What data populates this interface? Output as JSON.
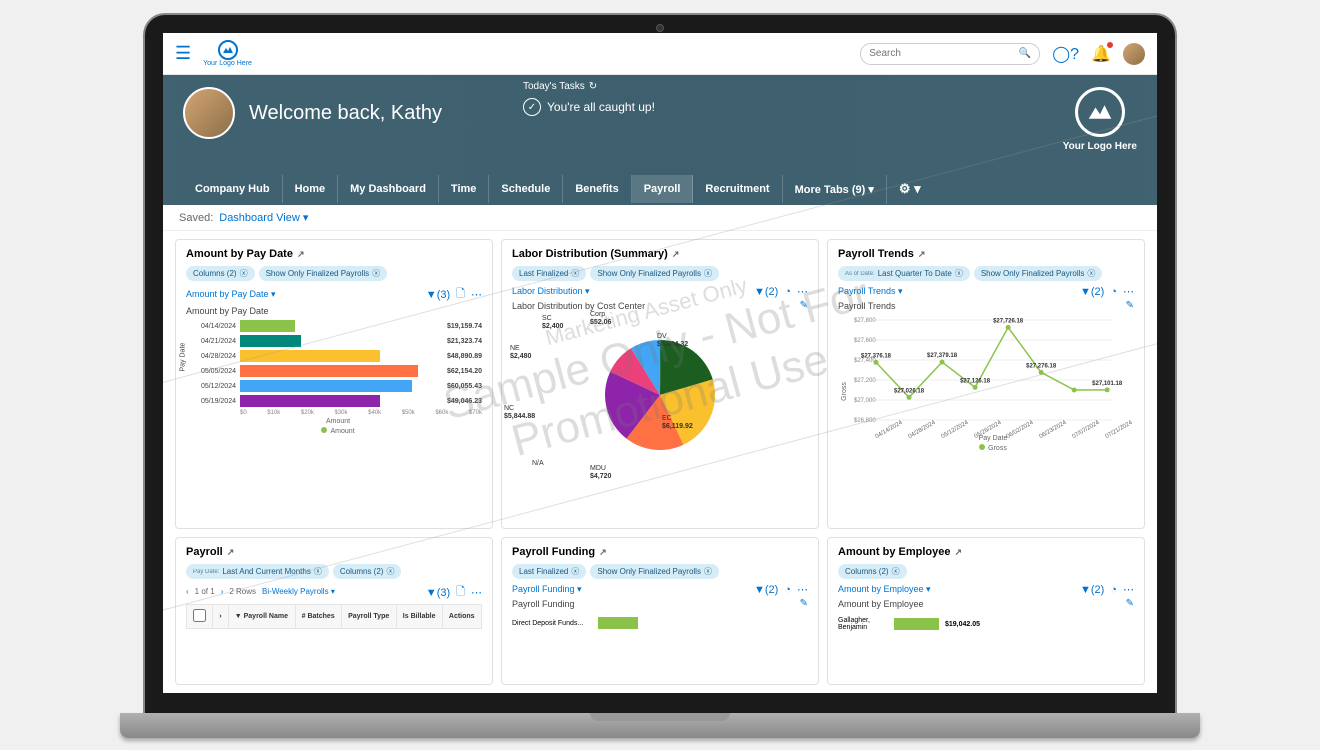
{
  "topbar": {
    "logo_text": "Your Logo Here",
    "search_placeholder": "Search"
  },
  "hero": {
    "welcome": "Welcome back, Kathy",
    "tasks_label": "Today's Tasks",
    "caught_up": "You're all caught up!",
    "logo_text": "Your Logo Here"
  },
  "nav": {
    "tabs": [
      "Company Hub",
      "Home",
      "My Dashboard",
      "Time",
      "Schedule",
      "Benefits",
      "Payroll",
      "Recruitment",
      "More Tabs (9)"
    ],
    "active": "Payroll"
  },
  "saved": {
    "label": "Saved:",
    "view": "Dashboard View"
  },
  "cards": {
    "amount_by_pay_date": {
      "title": "Amount by Pay Date",
      "pills": [
        "Columns (2)",
        "Show Only Finalized Payrolls"
      ],
      "sub_link": "Amount by Pay Date",
      "filter_count": "(3)",
      "subtitle": "Amount by Pay Date",
      "ylabel": "Pay Date",
      "xlabel": "Amount",
      "legend": "Amount",
      "x_ticks": [
        "$0",
        "$10k",
        "$20k",
        "$30k",
        "$40k",
        "$50k",
        "$60k",
        "$70k"
      ]
    },
    "labor_dist": {
      "title": "Labor Distribution (Summary)",
      "pills": [
        "Last Finalized",
        "Show Only Finalized Payrolls"
      ],
      "sub_link": "Labor Distribution",
      "filter_count": "(2)",
      "subtitle": "Labor Distribution by Cost Center"
    },
    "payroll_trends": {
      "title": "Payroll Trends",
      "pill1_sub": "As of Date:",
      "pills": [
        "Last Quarter To Date",
        "Show Only Finalized Payrolls"
      ],
      "sub_link": "Payroll Trends",
      "filter_count": "(2)",
      "subtitle": "Payroll Trends",
      "ylabel": "Gross",
      "xlabel": "Pay Date",
      "legend": "Gross",
      "y_ticks": [
        "$27,800",
        "$27,600",
        "$27,400",
        "$27,200",
        "$27,000",
        "$26,800"
      ]
    },
    "payroll": {
      "title": "Payroll",
      "pill1_sub": "Pay Date:",
      "pills": [
        "Last And Current Months",
        "Columns (2)"
      ],
      "paging": {
        "page": "1 of 1",
        "rows": "2 Rows",
        "group": "Bi-Weekly Payrolls"
      },
      "filter_count": "(3)",
      "columns": [
        "Payroll Name",
        "# Batches",
        "Payroll Type",
        "Is Billable",
        "Actions"
      ]
    },
    "payroll_funding": {
      "title": "Payroll Funding",
      "pills": [
        "Last Finalized",
        "Show Only Finalized Payrolls"
      ],
      "sub_link": "Payroll Funding",
      "filter_count": "(2)",
      "subtitle": "Payroll Funding",
      "row_label": "Direct Deposit Funds..."
    },
    "amount_by_employee": {
      "title": "Amount by Employee",
      "pills": [
        "Columns (2)"
      ],
      "sub_link": "Amount by Employee",
      "filter_count": "(2)",
      "subtitle": "Amount by Employee",
      "emp": {
        "name": "Gallagher, Benjamin",
        "value": "$19,042.05"
      }
    }
  },
  "chart_data": [
    {
      "id": "amount_by_pay_date",
      "type": "bar",
      "orientation": "horizontal",
      "xlabel": "Amount",
      "ylabel": "Pay Date",
      "xlim": [
        0,
        70000
      ],
      "categories": [
        "04/14/2024",
        "04/21/2024",
        "04/28/2024",
        "05/05/2024",
        "05/12/2024",
        "05/19/2024"
      ],
      "values": [
        19159.74,
        21323.74,
        48890.89,
        62154.2,
        60055.43,
        49046.23
      ],
      "labels": [
        "$19,159.74",
        "$21,323.74",
        "$48,890.89",
        "$62,154.20",
        "$60,055.43",
        "$49,046.23"
      ],
      "colors": [
        "#8bc34a",
        "#00897b",
        "#fbc02d",
        "#ff7043",
        "#42a5f5",
        "#8e24aa"
      ]
    },
    {
      "id": "labor_distribution",
      "type": "pie",
      "title": "Labor Distribution by Cost Center",
      "series": [
        {
          "name": "Corp",
          "value": 52.06,
          "label": "$52.06",
          "color": "#00897b"
        },
        {
          "name": "DV",
          "value": 5484.32,
          "label": "$5,484.32",
          "color": "#1b5e20"
        },
        {
          "name": "EC",
          "value": 6119.92,
          "label": "$6,119.92",
          "color": "#fbc02d"
        },
        {
          "name": "MDU",
          "value": 4720,
          "label": "$4,720",
          "color": "#ff7043"
        },
        {
          "name": "N/A",
          "value": 0,
          "label": "",
          "color": "#888"
        },
        {
          "name": "NC",
          "value": 5844.88,
          "label": "$5,844.88",
          "color": "#8e24aa"
        },
        {
          "name": "NE",
          "value": 2480,
          "label": "$2,480",
          "color": "#ec407a"
        },
        {
          "name": "SC",
          "value": 2400,
          "label": "$2,400",
          "color": "#42a5f5"
        }
      ]
    },
    {
      "id": "payroll_trends",
      "type": "line",
      "xlabel": "Pay Date",
      "ylabel": "Gross",
      "ylim": [
        26800,
        27800
      ],
      "x": [
        "04/14/2024",
        "04/28/2024",
        "05/12/2024",
        "05/26/2024",
        "06/02/2024",
        "06/23/2024",
        "07/07/2024",
        "07/21/2024"
      ],
      "series": [
        {
          "name": "Gross",
          "values": [
            27376.18,
            27026.18,
            27379.18,
            27126.18,
            27726.18,
            27276.18,
            27100,
            27101.18
          ],
          "labels": [
            "$27,376.18",
            "$27,026.18",
            "$27,379.18",
            "$27,126.18",
            "$27,726.18",
            "$27,276.18",
            "",
            "$27,101.18"
          ]
        }
      ],
      "color": "#8bc34a"
    }
  ],
  "watermark": {
    "line1": "Marketing Asset Only",
    "line2": "Sample Only - Not For",
    "line3": "Promotional Use"
  }
}
